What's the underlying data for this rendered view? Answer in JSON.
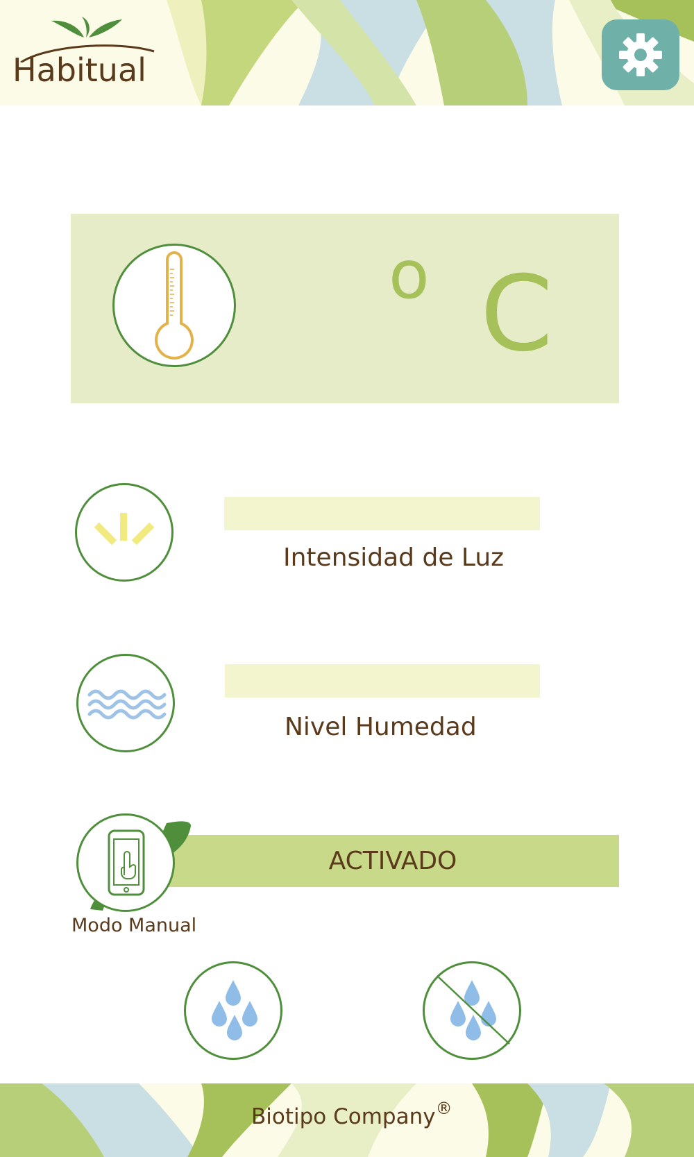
{
  "header": {
    "brand": "Habitual",
    "settings_icon": "gear-icon",
    "colors": {
      "header_green": "#a7c15a",
      "header_blue": "#c9dfe4",
      "settings_bg": "#6fb0a8"
    }
  },
  "temperature": {
    "icon": "thermometer-icon",
    "degree_symbol": "o",
    "unit": "C"
  },
  "light": {
    "icon": "sun-rays-icon",
    "label": "Intensidad de Luz"
  },
  "humidity": {
    "icon": "waves-icon",
    "label": "Nivel Humedad"
  },
  "manual_mode": {
    "icon": "phone-touch-icon",
    "label": "Modo Manual",
    "status": "ACTIVADO"
  },
  "watering": {
    "on_icon": "water-drops-icon",
    "off_icon": "water-drops-off-icon"
  },
  "footer": {
    "company": "Biotipo Company",
    "registered": "®"
  }
}
